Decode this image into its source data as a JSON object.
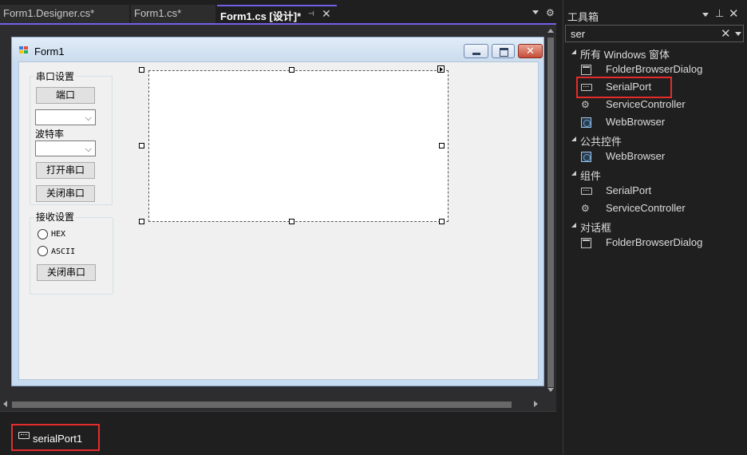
{
  "tabs": [
    {
      "label": "Form1.Designer.cs*",
      "active": false
    },
    {
      "label": "Form1.cs*",
      "active": false
    },
    {
      "label": "Form1.cs [设计]*",
      "active": true
    }
  ],
  "form": {
    "title": "Form1",
    "serial_group": {
      "label": "串口设置",
      "port_button": "端口",
      "baud_label": "波特率",
      "open_button": "打开串口",
      "close_button": "关闭串口"
    },
    "receive_group": {
      "label": "接收设置",
      "hex_label": "HEX",
      "ascii_label": "ASCII",
      "close_button": "关闭串口"
    },
    "close_glyph": "✕"
  },
  "tray": {
    "component": "serialPort1",
    "icon": "serial-port-icon"
  },
  "toolbox": {
    "title": "工具箱",
    "search_value": "ser",
    "categories": [
      {
        "label": "所有 Windows 窗体",
        "items": [
          {
            "label": "FolderBrowserDialog",
            "icon": "dialog-icon"
          },
          {
            "label": "SerialPort",
            "icon": "serial-port-icon",
            "highlighted": true
          },
          {
            "label": "ServiceController",
            "icon": "gear-icon"
          },
          {
            "label": "WebBrowser",
            "icon": "web-browser-icon"
          }
        ]
      },
      {
        "label": "公共控件",
        "items": [
          {
            "label": "WebBrowser",
            "icon": "web-browser-icon"
          }
        ]
      },
      {
        "label": "组件",
        "items": [
          {
            "label": "SerialPort",
            "icon": "serial-port-icon"
          },
          {
            "label": "ServiceController",
            "icon": "gear-icon"
          }
        ]
      },
      {
        "label": "对话框",
        "items": [
          {
            "label": "FolderBrowserDialog",
            "icon": "dialog-icon"
          }
        ]
      }
    ]
  },
  "colors": {
    "accent": "#7160e8",
    "highlight_border": "#e52b2b",
    "ide_background": "#1f1f1f",
    "form_background": "#f0f0f0"
  }
}
